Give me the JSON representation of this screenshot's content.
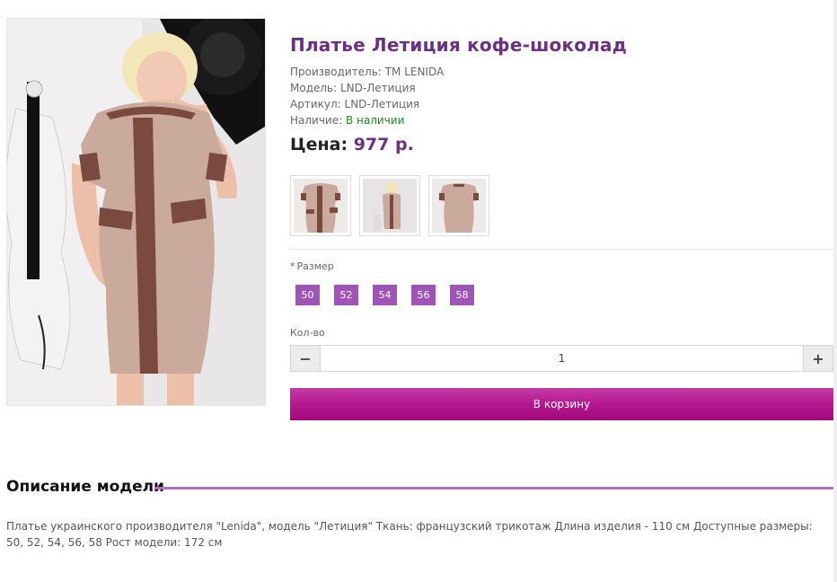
{
  "product": {
    "title": "Платье Летиция кофе-шоколад",
    "manufacturer_label": "Производитель:",
    "manufacturer": "ТМ LENIDA",
    "model_label": "Модель:",
    "model": "LND-Летиция",
    "sku_label": "Артикул:",
    "sku": "LND-Летиция",
    "availability_label": "Наличие:",
    "availability": "В наличии",
    "price_label": "Цена:",
    "price": "977 р."
  },
  "size": {
    "required_mark": "*",
    "label": "Размер",
    "options": [
      "50",
      "52",
      "54",
      "56",
      "58"
    ]
  },
  "quantity": {
    "label": "Кол-во",
    "value": "1",
    "minus": "−",
    "plus": "+"
  },
  "cart": {
    "button_label": "В корзину"
  },
  "description": {
    "heading": "Описание модели",
    "text": "Платье украинского производителя \"Lenida\", модель \"Летиция\" Ткань: французский трикотаж Длина изделия - 110 см Доступные размеры: 50, 52, 54, 56, 58 Рост модели: 172 см"
  },
  "colors": {
    "accent": "#6d2f82",
    "size_button": "#a154b8",
    "cart_button": "#b5178f",
    "in_stock": "#1e8a1e",
    "dress_beige": "#c9aa9d",
    "dress_brown": "#7a4a3f"
  },
  "icons": {
    "minus": "minus-icon",
    "plus": "plus-icon"
  }
}
